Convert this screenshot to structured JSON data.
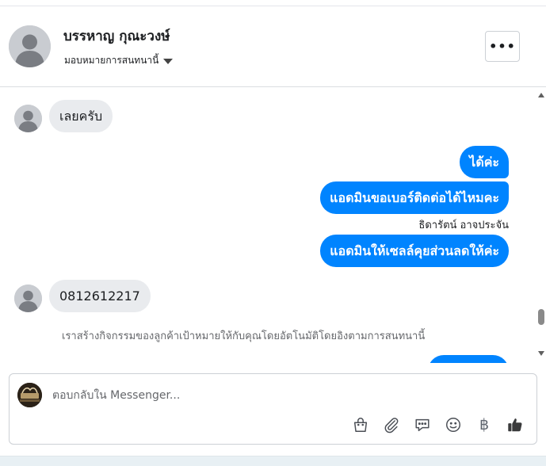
{
  "header": {
    "contact_name": "บรรหาญ กุณะวงษ์",
    "assign_label": "มอบหมายการสนทนานี้",
    "more_label": "•••"
  },
  "thread": {
    "messages": [
      {
        "direction": "in",
        "text": "เลยครับ"
      },
      {
        "direction": "out",
        "text": "ได้ค่ะ"
      },
      {
        "direction": "out",
        "text": "แอดมินขอเบอร์ติดต่อได้ไหมคะ"
      },
      {
        "direction": "out",
        "sender": "ธิดารัตน์ อาจประจัน",
        "text": "แอดมินให้เซลล์คุยส่วนลดให้ค่ะ"
      },
      {
        "direction": "in",
        "text": "0812612217"
      }
    ],
    "system_note": "เราสร้างกิจกรรมของลูกค้าเป้าหมายให้กับคุณโดยอัตโนมัติโดยอิงตามการสนทนานี้"
  },
  "composer": {
    "placeholder": "ตอบกลับใน Messenger...",
    "tools": [
      "shopping-bag-icon",
      "paperclip-icon",
      "saved-reply-icon",
      "emoji-icon",
      "baht-icon",
      "thumbs-up-icon"
    ],
    "baht_symbol": "฿"
  },
  "colors": {
    "outgoing_bubble": "#0084ff",
    "incoming_bubble": "#e9ebee"
  }
}
